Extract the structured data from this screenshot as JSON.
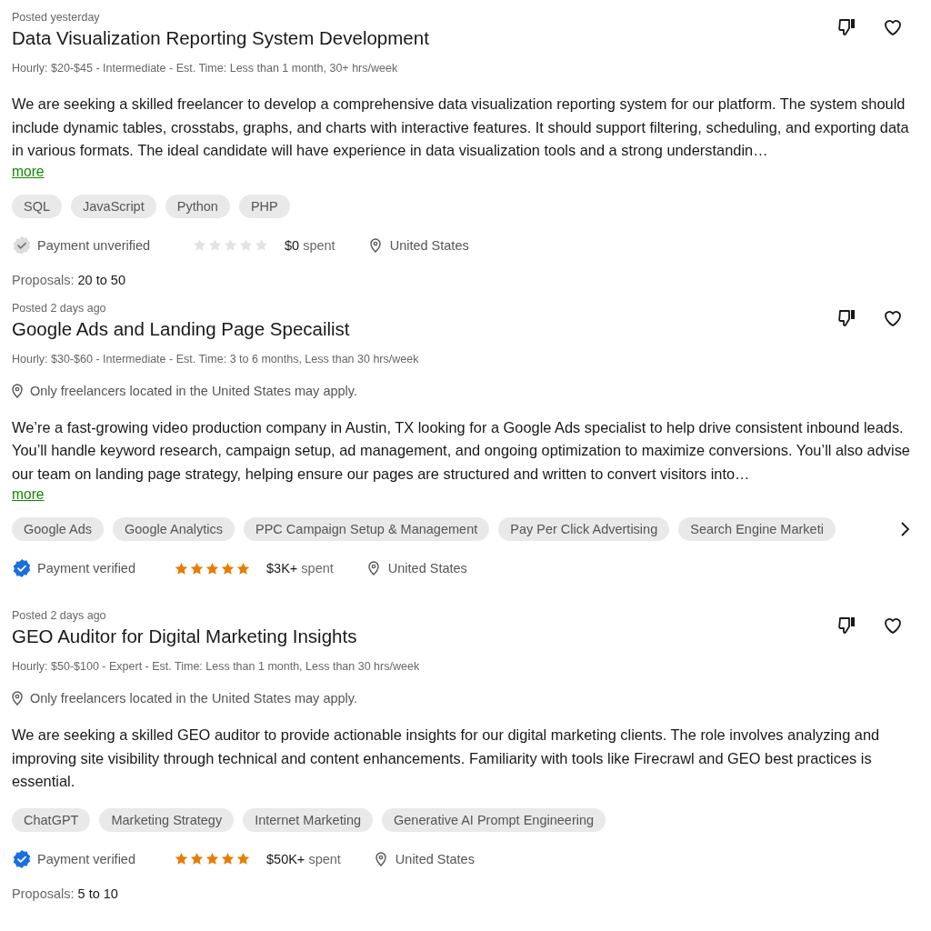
{
  "jobs": [
    {
      "posted": "Posted yesterday",
      "title": "Data Visualization Reporting System Development",
      "meta": "Hourly: $20-$45 - Intermediate - Est. Time: Less than 1 month, 30+ hrs/week",
      "description": "We are seeking a skilled freelancer to develop a comprehensive data visualization reporting system for our platform. The system should include dynamic tables, crosstabs, graphs, and charts with interactive features. It should support filtering, scheduling, and exporting data in various formats. The ideal candidate will have experience in data visualization tools and a strong understandin…",
      "more": "more",
      "skills": [
        "SQL",
        "JavaScript",
        "Python",
        "PHP"
      ],
      "payment_verified": false,
      "payment": "Payment unverified",
      "stars": 0,
      "spent_amount": "$0",
      "spent_label": "spent",
      "location": "United States",
      "proposals_label": "Proposals:",
      "proposals": "20 to 50"
    },
    {
      "posted": "Posted 2 days ago",
      "title": "Google Ads and Landing Page Specailist",
      "meta": "Hourly: $30-$60 - Intermediate - Est. Time: 3 to 6 months, Less than 30 hrs/week",
      "location_note": "Only freelancers located in the United States may apply.",
      "description": "We’re a fast-growing video production company in Austin, TX looking for a Google Ads specialist to help drive consistent inbound leads. You’ll handle keyword research, campaign setup, ad management, and ongoing optimization to maximize conversions. You’ll also advise our team on landing page strategy, helping ensure our pages are structured and written to convert visitors into…",
      "more": "more",
      "skills": [
        "Google Ads",
        "Google Analytics",
        "PPC Campaign Setup & Management",
        "Pay Per Click Advertising",
        "Search Engine Marketi"
      ],
      "skills_more": true,
      "payment_verified": true,
      "payment": "Payment verified",
      "stars": 5,
      "spent_amount": "$3K+",
      "spent_label": "spent",
      "location": "United States"
    },
    {
      "posted": "Posted 2 days ago",
      "title": "GEO Auditor for Digital Marketing Insights",
      "meta": "Hourly: $50-$100 - Expert - Est. Time: Less than 1 month, Less than 30 hrs/week",
      "location_note": "Only freelancers located in the United States may apply.",
      "description": "We are seeking a skilled GEO auditor to provide actionable insights for our digital marketing clients. The role involves analyzing and improving site visibility through technical and content enhancements. Familiarity with tools like Firecrawl and GEO best practices is essential.",
      "skills": [
        "ChatGPT",
        "Marketing Strategy",
        "Internet Marketing",
        "Generative AI Prompt Engineering"
      ],
      "payment_verified": true,
      "payment": "Payment verified",
      "stars": 5,
      "spent_amount": "$50K+",
      "spent_label": "spent",
      "location": "United States",
      "proposals_label": "Proposals:",
      "proposals": "5 to 10"
    }
  ]
}
